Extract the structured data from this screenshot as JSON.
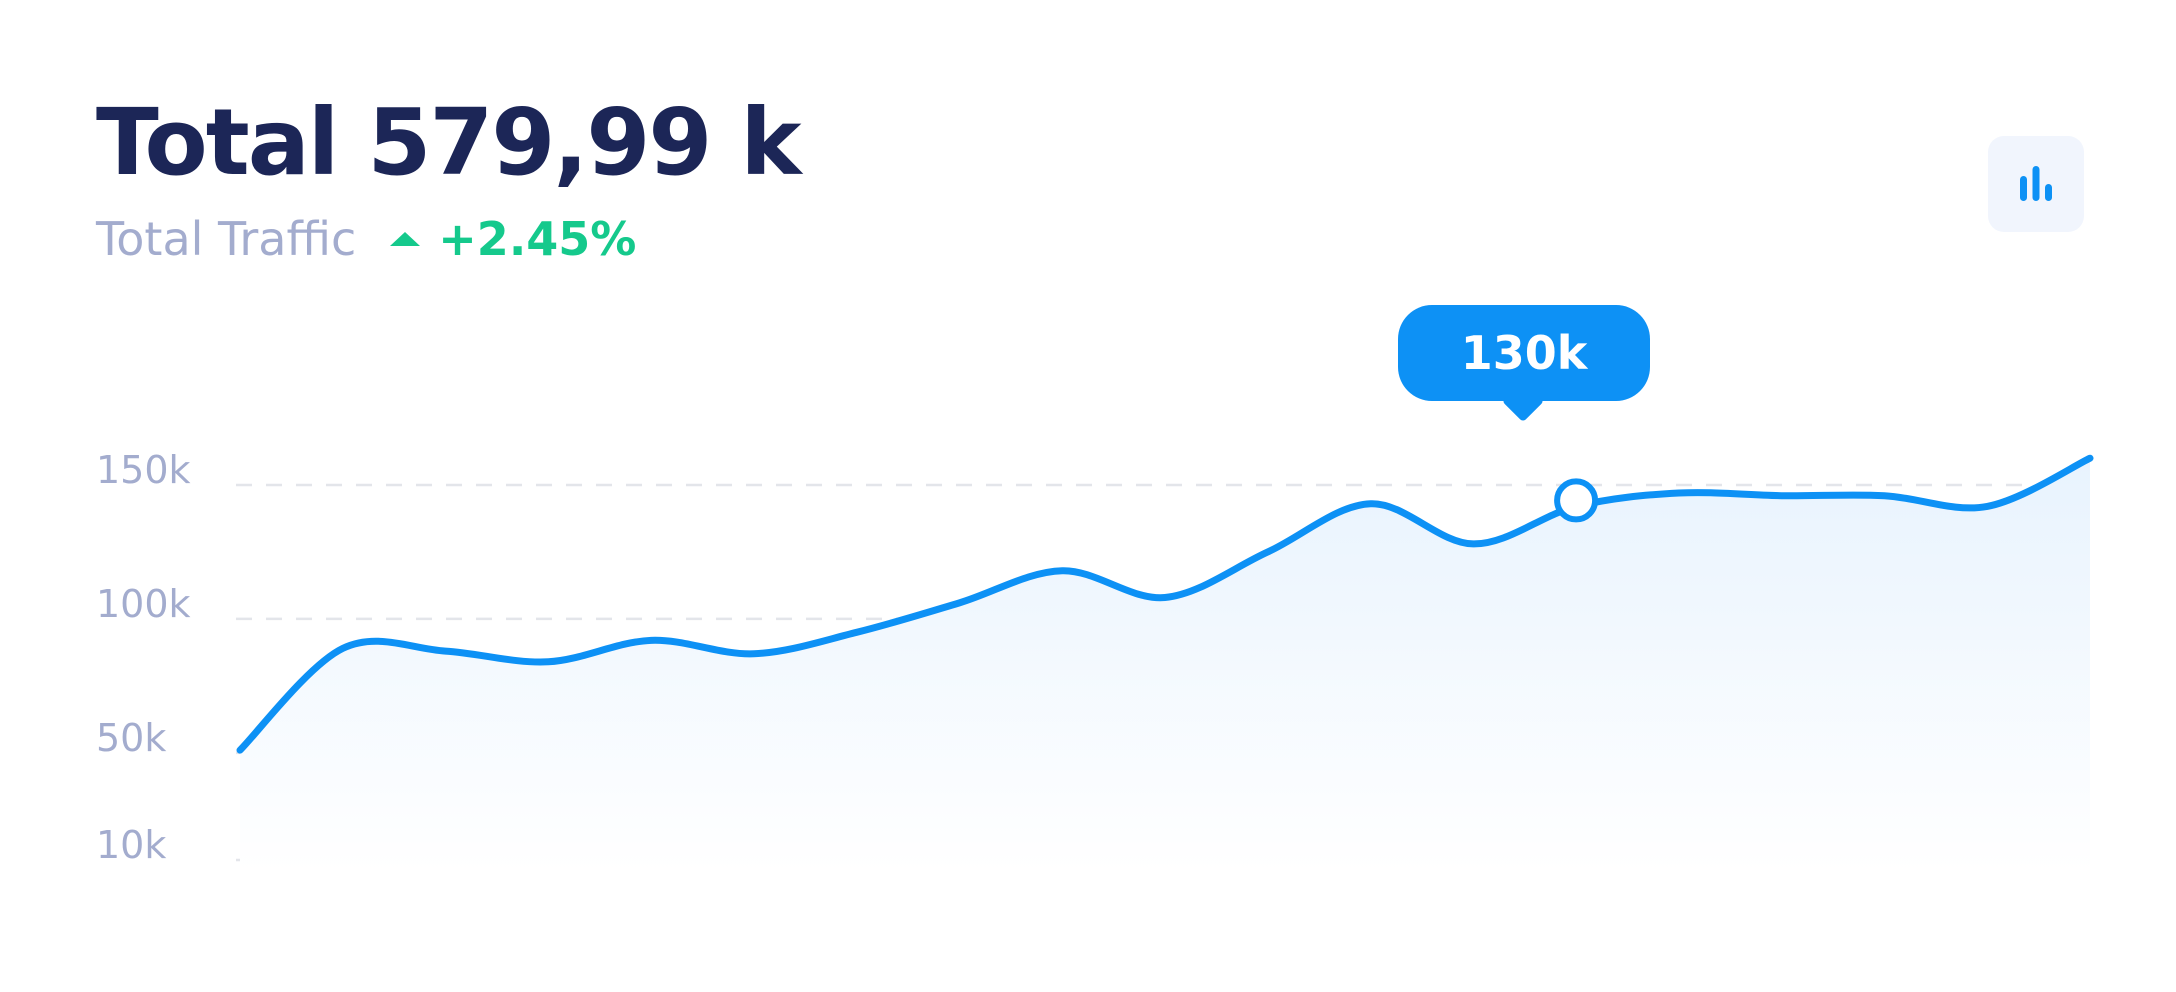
{
  "header": {
    "total": "Total 579,99 k",
    "subtitle": "Total Traffic",
    "delta": "+2.45%"
  },
  "icons": {
    "delta_arrow": "triangle-up-icon",
    "chart_toggle": "bar-chart-icon"
  },
  "colors": {
    "title": "#1c2657",
    "muted": "#a3acce",
    "positive": "#15c98c",
    "line": "#0d91f5",
    "grid": "#e3e5ea"
  },
  "chart_data": {
    "type": "area",
    "title": "",
    "xlabel": "",
    "ylabel": "",
    "y_ticks": [
      "150k",
      "100k",
      "50k",
      "10k"
    ],
    "y_tick_values": [
      150,
      100,
      50,
      10
    ],
    "ylim": [
      10,
      150
    ],
    "grid": true,
    "series": [
      {
        "values": [
          51,
          89,
          88,
          84,
          92,
          87,
          95,
          106,
          118,
          108,
          125,
          143,
          128,
          142,
          147,
          146,
          146,
          142,
          160
        ]
      }
    ],
    "highlight": {
      "label": "130k",
      "index": 13
    }
  }
}
